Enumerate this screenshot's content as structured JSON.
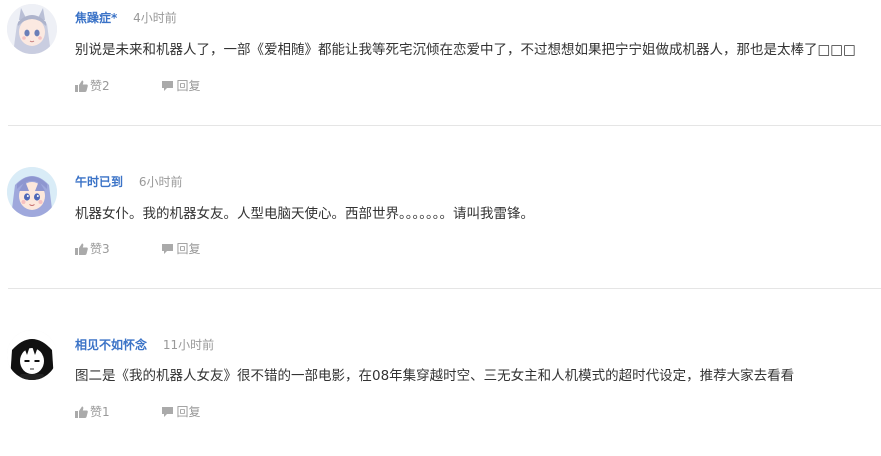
{
  "comments": [
    {
      "username": "焦躁症*",
      "time": "4小时前",
      "text": "别说是未来和机器人了，一部《爱相随》都能让我等死宅沉倾在恋爱中了，不过想想如果把宁宁姐做成机器人，那也是太棒了□□□",
      "likes_label": "赞2",
      "reply_label": "回复"
    },
    {
      "username": "午时已到",
      "time": "6小时前",
      "text": "机器女仆。我的机器女友。人型电脑天使心。西部世界。。。。。。。请叫我雷锋。",
      "likes_label": "赞3",
      "reply_label": "回复"
    },
    {
      "username": "相见不如怀念",
      "time": "11小时前",
      "text": "图二是《我的机器人女友》很不错的一部电影，在08年集穿越时空、三无女主和人机模式的超时代设定，推荐大家去看看",
      "likes_label": "赞1",
      "reply_label": "回复"
    }
  ],
  "colors": {
    "username": "#3b73c7",
    "meta": "#999999",
    "text": "#333333",
    "divider": "#e5e5e5"
  },
  "icons": {
    "like": "thumbs-up-icon",
    "reply": "speech-bubble-icon"
  }
}
